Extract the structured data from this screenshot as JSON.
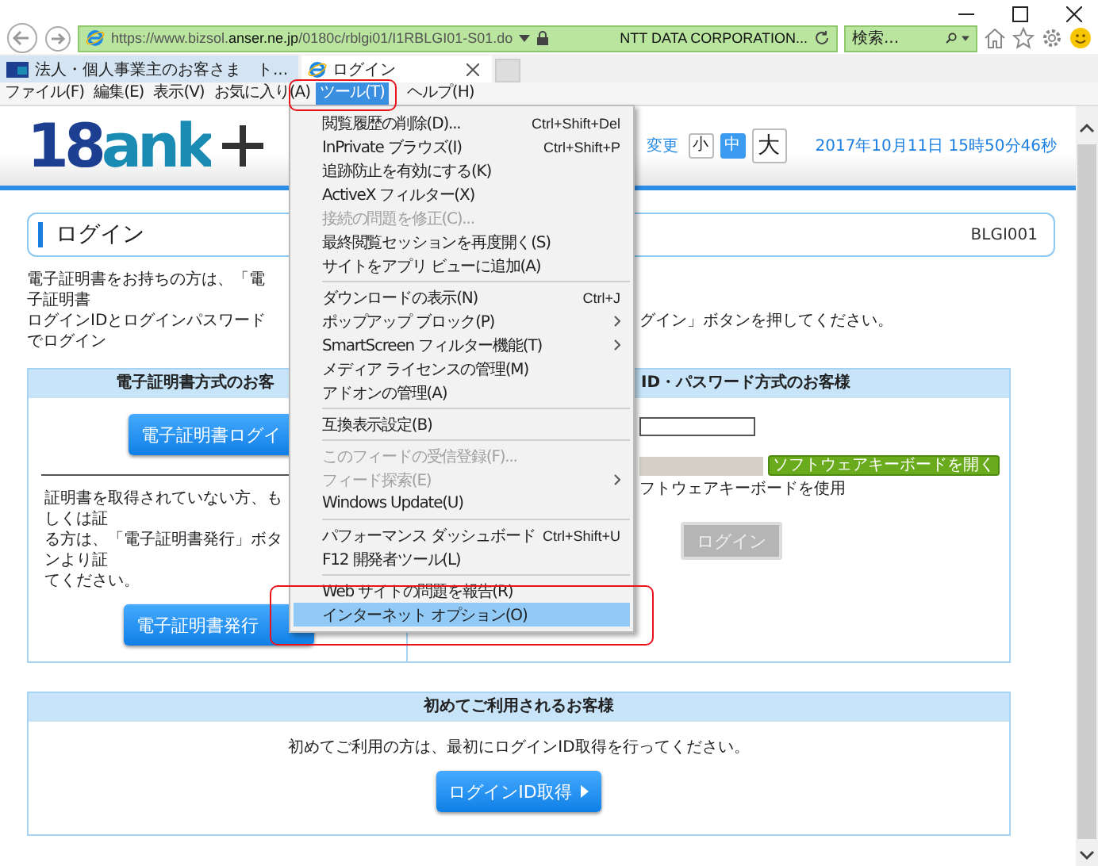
{
  "address_bar": {
    "url": "https://www.bizsol.**anser.ne.jp**/0180c/rblgi01/I1RBLGI01-S01.do",
    "certificate": "NTT DATA CORPORATION..."
  },
  "search": {
    "placeholder": "検索..."
  },
  "tabs": [
    {
      "label": "法人・個人事業主のお客さま　ト...",
      "selected": false
    },
    {
      "label": "ログイン",
      "selected": true
    }
  ],
  "menu_bar": [
    {
      "label": "ファイル(F)",
      "selected": false
    },
    {
      "label": "編集(E)",
      "selected": false
    },
    {
      "label": "表示(V)",
      "selected": false
    },
    {
      "label": "お気に入り(A)",
      "selected": false
    },
    {
      "label": "ツール(T)",
      "selected": true
    },
    {
      "label": "ヘルプ(H)",
      "selected": false
    }
  ],
  "tools_menu": [
    {
      "kind": "item",
      "label": "閲覧履歴の削除(D)...",
      "shortcut": "Ctrl+Shift+Del",
      "submenu": false,
      "disabled": false,
      "selected": false
    },
    {
      "kind": "item",
      "label": "InPrivate ブラウズ(I)",
      "shortcut": "Ctrl+Shift+P",
      "submenu": false,
      "disabled": false,
      "selected": false
    },
    {
      "kind": "item",
      "label": "追跡防止を有効にする(K)",
      "submenu": false,
      "disabled": false,
      "selected": false
    },
    {
      "kind": "item",
      "label": "ActiveX フィルター(X)",
      "submenu": false,
      "disabled": false,
      "selected": false
    },
    {
      "kind": "item",
      "label": "接続の問題を修正(C)...",
      "submenu": false,
      "disabled": true,
      "selected": false
    },
    {
      "kind": "item",
      "label": "最終閲覧セッションを再度開く(S)",
      "submenu": false,
      "disabled": false,
      "selected": false
    },
    {
      "kind": "item",
      "label": "サイトをアプリ ビューに追加(A)",
      "submenu": false,
      "disabled": false,
      "selected": false
    },
    {
      "kind": "separator"
    },
    {
      "kind": "item",
      "label": "ダウンロードの表示(N)",
      "shortcut": "Ctrl+J",
      "submenu": false,
      "disabled": false,
      "selected": false
    },
    {
      "kind": "item",
      "label": "ポップアップ ブロック(P)",
      "submenu": true,
      "disabled": false,
      "selected": false
    },
    {
      "kind": "item",
      "label": "SmartScreen フィルター機能(T)",
      "submenu": true,
      "disabled": false,
      "selected": false
    },
    {
      "kind": "item",
      "label": "メディア ライセンスの管理(M)",
      "submenu": false,
      "disabled": false,
      "selected": false
    },
    {
      "kind": "item",
      "label": "アドオンの管理(A)",
      "submenu": false,
      "disabled": false,
      "selected": false
    },
    {
      "kind": "separator"
    },
    {
      "kind": "item",
      "label": "互換表示設定(B)",
      "submenu": false,
      "disabled": false,
      "selected": false
    },
    {
      "kind": "separator"
    },
    {
      "kind": "item",
      "label": "このフィードの受信登録(F)...",
      "submenu": false,
      "disabled": true,
      "selected": false
    },
    {
      "kind": "item",
      "label": "フィード探索(E)",
      "submenu": true,
      "disabled": true,
      "selected": false
    },
    {
      "kind": "item",
      "label": "Windows Update(U)",
      "submenu": false,
      "disabled": false,
      "selected": false
    },
    {
      "kind": "separator"
    },
    {
      "kind": "item",
      "label": "パフォーマンス ダッシュボード",
      "shortcut": "Ctrl+Shift+U",
      "submenu": false,
      "disabled": false,
      "selected": false
    },
    {
      "kind": "item",
      "label": "F12 開発者ツール(L)",
      "submenu": false,
      "disabled": false,
      "selected": false
    },
    {
      "kind": "separator"
    },
    {
      "kind": "item",
      "label": "Web サイトの問題を報告(R)",
      "submenu": false,
      "disabled": false,
      "selected": false
    },
    {
      "kind": "item",
      "label": "インターネット オプション(O)",
      "submenu": false,
      "disabled": false,
      "selected": true
    }
  ],
  "page": {
    "logo": "18ank",
    "font_size_label": "変更",
    "font_sizes": [
      {
        "label": "小",
        "selected": false
      },
      {
        "label": "中",
        "selected": true
      },
      {
        "label": "大",
        "selected": false
      }
    ],
    "datetime": "2017年10月11日 15時50分46秒",
    "title": "ログイン",
    "screen_id": "BLGI001",
    "intro_left": [
      "電子証明書をお持ちの方は、「電子証明書",
      "ログインIDとログインパスワードでログイン"
    ],
    "intro_right": "グイン」ボタンを押してください。"
  },
  "cert_panel": {
    "title": "電子証明書方式のお客",
    "login_button": "電子証明書ログイ",
    "note": [
      "証明書を取得されていない方、もしくは証",
      "る方は、「電子証明書発行」ボタンより証",
      "てください。"
    ],
    "issue_button": "電子証明書発行"
  },
  "id_panel": {
    "title": "ID・パスワード方式のお客様",
    "password_field": {
      "disabled": true
    },
    "keyboard_button": "ソフトウェアキーボードを開く",
    "keyboard_option": "フトウェアキーボードを使用",
    "login_button": {
      "label": "ログイン",
      "disabled": true
    }
  },
  "first_panel": {
    "title": "初めてご利用されるお客様",
    "text": "初めてご利用の方は、最初にログインID取得を行ってください。",
    "button": "ログインID取得"
  }
}
